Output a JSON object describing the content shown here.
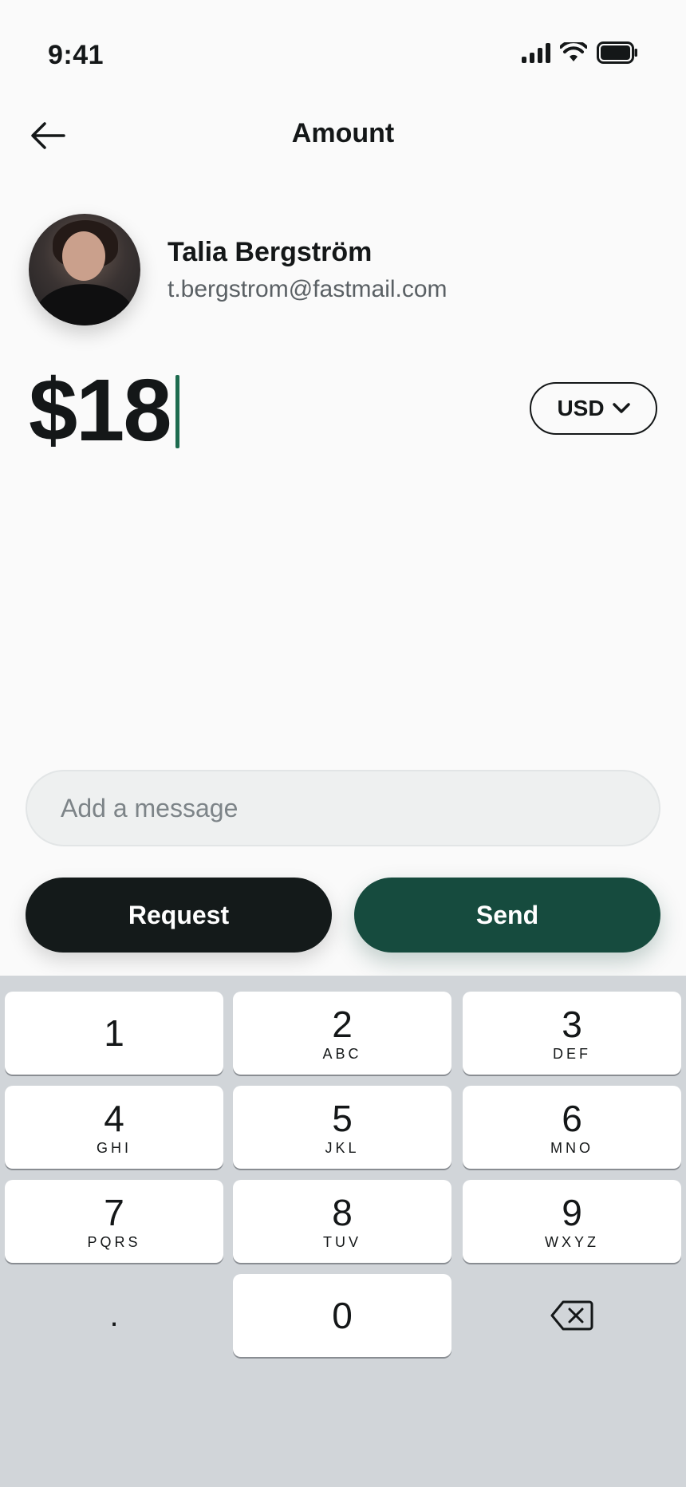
{
  "status": {
    "time": "9:41"
  },
  "header": {
    "title": "Amount",
    "back_icon": "arrow-left-icon"
  },
  "recipient": {
    "name": "Talia Bergström",
    "email": "t.bergstrom@fastmail.com"
  },
  "amount": {
    "value": "$18",
    "currency": "USD"
  },
  "message": {
    "placeholder": "Add a message",
    "value": ""
  },
  "actions": {
    "request_label": "Request",
    "send_label": "Send"
  },
  "keypad": {
    "keys": [
      {
        "digit": "1",
        "letters": ""
      },
      {
        "digit": "2",
        "letters": "ABC"
      },
      {
        "digit": "3",
        "letters": "DEF"
      },
      {
        "digit": "4",
        "letters": "GHI"
      },
      {
        "digit": "5",
        "letters": "JKL"
      },
      {
        "digit": "6",
        "letters": "MNO"
      },
      {
        "digit": "7",
        "letters": "PQRS"
      },
      {
        "digit": "8",
        "letters": "TUV"
      },
      {
        "digit": "9",
        "letters": "WXYZ"
      },
      {
        "digit": ".",
        "letters": ""
      },
      {
        "digit": "0",
        "letters": ""
      },
      {
        "digit": "",
        "letters": ""
      }
    ]
  },
  "colors": {
    "accent": "#164b3e",
    "caret": "#1d6b4f",
    "dark": "#141a1a",
    "keypad_bg": "#d1d5d9"
  }
}
